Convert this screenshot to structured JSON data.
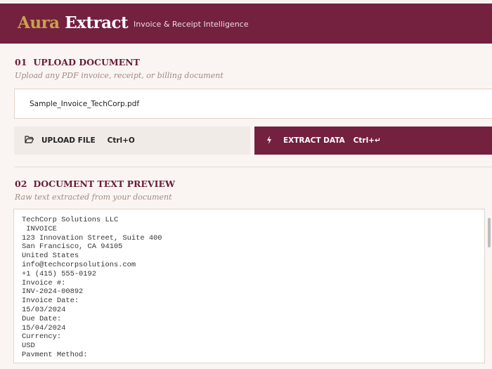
{
  "header": {
    "brand_part1": "Aura",
    "brand_part2": "Extract",
    "tagline": "Invoice & Receipt Intelligence"
  },
  "upload_section": {
    "number": "01",
    "title": "UPLOAD DOCUMENT",
    "subtitle": "Upload any PDF invoice, receipt, or billing document",
    "file_name": "Sample_Invoice_TechCorp.pdf",
    "upload_button": {
      "label": "UPLOAD FILE",
      "shortcut": "Ctrl+O",
      "icon": "folder-open-icon"
    },
    "extract_button": {
      "label": "EXTRACT DATA",
      "shortcut": "Ctrl+↵",
      "icon": "lightning-icon"
    }
  },
  "preview_section": {
    "number": "02",
    "title": "DOCUMENT TEXT PREVIEW",
    "subtitle": "Raw text extracted from your document",
    "text": "TechCorp Solutions LLC\n INVOICE\n123 Innovation Street, Suite 400\nSan Francisco, CA 94105\nUnited States\ninfo@techcorpsolutions.com\n+1 (415) 555-0192\nInvoice #:\nINV-2024-00892\nInvoice Date:\n15/03/2024\nDue Date:\n15/04/2024\nCurrency:\nUSD\nPayment Method:"
  },
  "colors": {
    "primary": "#74203f",
    "gold": "#c9a24a",
    "background": "#faf5f3"
  }
}
